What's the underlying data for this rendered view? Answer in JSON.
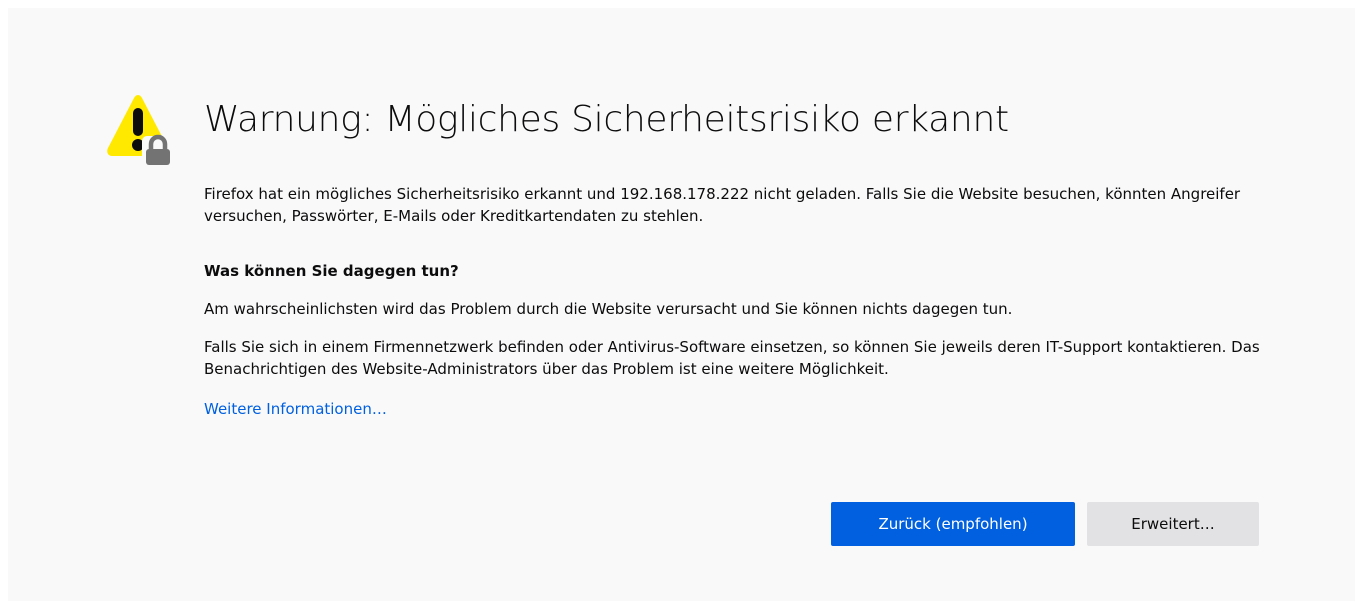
{
  "error_page": {
    "title": "Warnung: Mögliches Sicherheitsrisiko erkannt",
    "intro": "Firefox hat ein mögliches Sicherheitsrisiko erkannt und 192.168.178.222 nicht geladen. Falls Sie die Website besuchen, könnten Angreifer versuchen, Passwörter, E-Mails oder Kreditkartendaten zu stehlen.",
    "what_heading": "Was können Sie dagegen tun?",
    "paragraph_1": "Am wahrscheinlichsten wird das Problem durch die Website verursacht und Sie können nichts dagegen tun.",
    "paragraph_2": "Falls Sie sich in einem Firmennetzwerk befinden oder Antivirus-Software einsetzen, so können Sie jeweils deren IT-Support kontaktieren. Das Benachrichtigen des Website-Administrators über das Problem ist eine weitere Möglichkeit.",
    "more_info_link": "Weitere Informationen…",
    "icon": "warning-lock-icon"
  },
  "buttons": {
    "back_label": "Zurück (empfohlen)",
    "advanced_label": "Erweitert…"
  },
  "colors": {
    "accent": "#0060df",
    "warning_yellow": "#ffe900",
    "background": "#f9f9fa",
    "text": "#0c0c0d"
  }
}
